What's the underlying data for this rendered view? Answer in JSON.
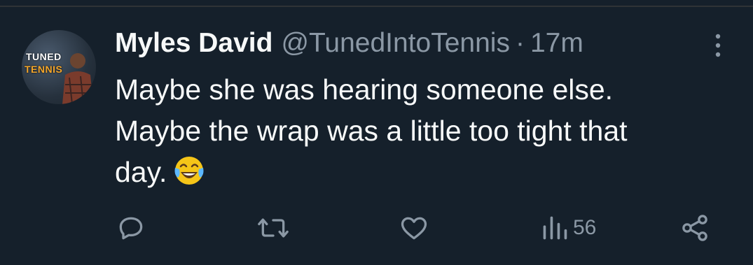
{
  "tweet": {
    "author": {
      "display_name": "Myles David",
      "handle": "@TunedIntoTennis",
      "avatar_text_top": "TUNED",
      "avatar_text_bottom": "TENNIS"
    },
    "separator": "·",
    "timestamp": "17m",
    "text_line1": "Maybe she was hearing someone else.",
    "text_line2": "Maybe the wrap was a little too tight that",
    "text_line3": "day.",
    "emoji": "face-with-tears-of-joy",
    "actions": {
      "reply_icon": "reply-icon",
      "retweet_icon": "retweet-icon",
      "like_icon": "heart-icon",
      "views_icon": "views-icon",
      "views_count": "56",
      "share_icon": "share-icon"
    }
  },
  "colors": {
    "background": "#15202b",
    "text_primary": "#f7f9f9",
    "text_secondary": "#8b98a5",
    "divider": "#2f3336"
  }
}
